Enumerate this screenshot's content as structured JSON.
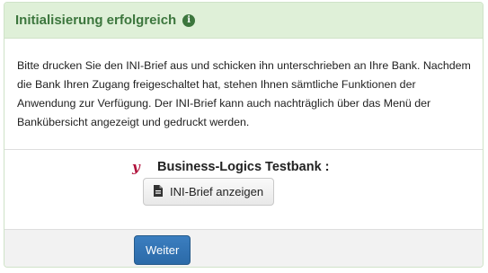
{
  "header": {
    "title": "Initialisierung erfolgreich",
    "info_icon": "info-circle-icon"
  },
  "body": {
    "message": "Bitte drucken Sie den INI-Brief aus und schicken ihn unterschrieben an Ihre Bank. Nachdem die Bank Ihren Zugang freigeschaltet hat, stehen Ihnen sämtliche Funktionen der Anwendung zur Verfügung. Der INI-Brief kann auch nachträglich über das Menü der Bankübersicht angezeigt und gedruckt werden."
  },
  "bank": {
    "logo_letter": "y",
    "name": "Business-Logics Testbank :",
    "show_letter_label": "INI-Brief anzeigen",
    "show_letter_icon": "file-icon"
  },
  "footer": {
    "next_label": "Weiter"
  },
  "colors": {
    "header_bg": "#dff0d8",
    "header_text": "#3c763d",
    "primary": "#337ab7",
    "logo": "#b0103a"
  }
}
